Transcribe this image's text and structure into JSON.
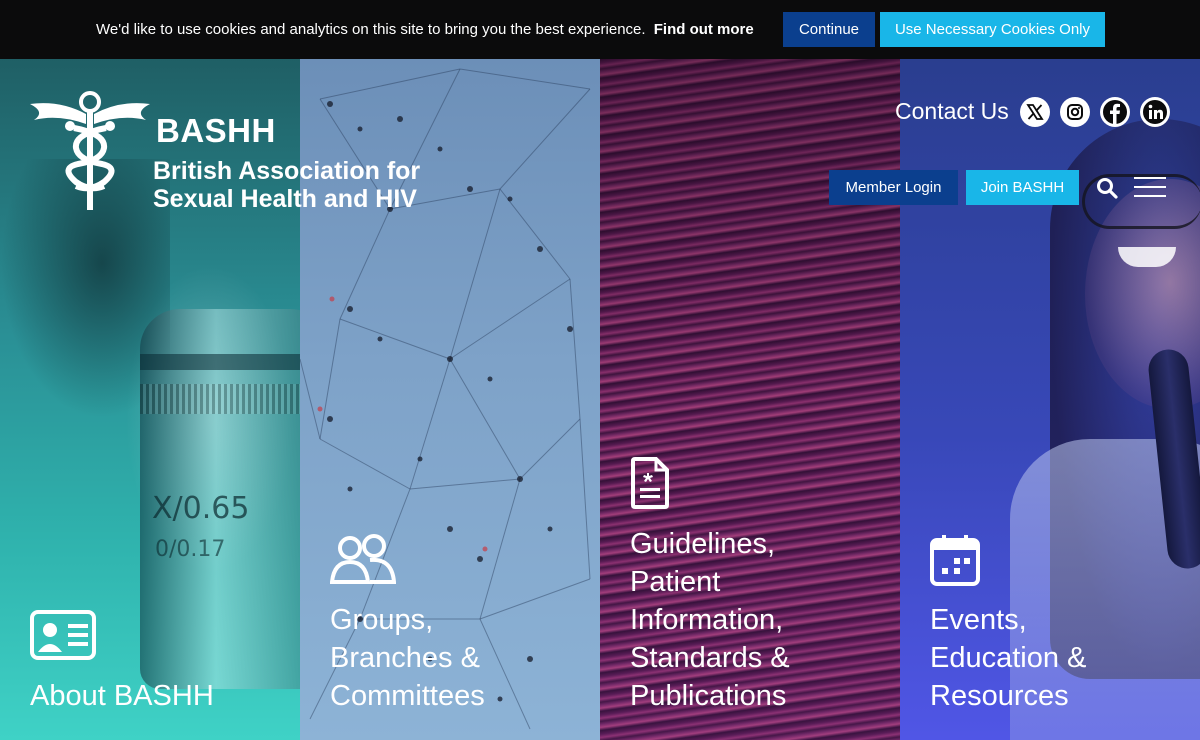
{
  "cookie_bar": {
    "message": "We'd like to use cookies and analytics on this site to bring you the best experience.",
    "link": "Find out more",
    "continue_label": "Continue",
    "necessary_label": "Use Necessary Cookies Only"
  },
  "logo": {
    "name": "BASHH",
    "line1": "British Association for",
    "line2": "Sexual Health and HIV",
    "icon": "caduceus-icon"
  },
  "header": {
    "contact_label": "Contact Us",
    "social": [
      "x-icon",
      "instagram-icon",
      "facebook-icon",
      "linkedin-icon"
    ],
    "member_login_label": "Member Login",
    "join_label": "Join BASHH",
    "search_icon": "search-icon",
    "menu_icon": "hamburger-menu-icon"
  },
  "panels": [
    {
      "icon": "id-card-icon",
      "lines": [
        "About BASHH"
      ]
    },
    {
      "icon": "users-icon",
      "lines": [
        "Groups,",
        "Branches &",
        "Committees"
      ]
    },
    {
      "icon": "document-medical-icon",
      "lines": [
        "Guidelines,",
        "Patient",
        "Information,",
        "Standards &",
        "Publications"
      ]
    },
    {
      "icon": "calendar-icon",
      "lines": [
        "Events,",
        "Education &",
        "Resources"
      ]
    }
  ],
  "photo_text": {
    "lens_value": "X/0.65",
    "lens_sub": "0/0.17"
  },
  "colors": {
    "cookie_bg": "#0b0b0c",
    "primary_blue": "#0b3f8e",
    "accent_cyan": "#19b6e8"
  }
}
